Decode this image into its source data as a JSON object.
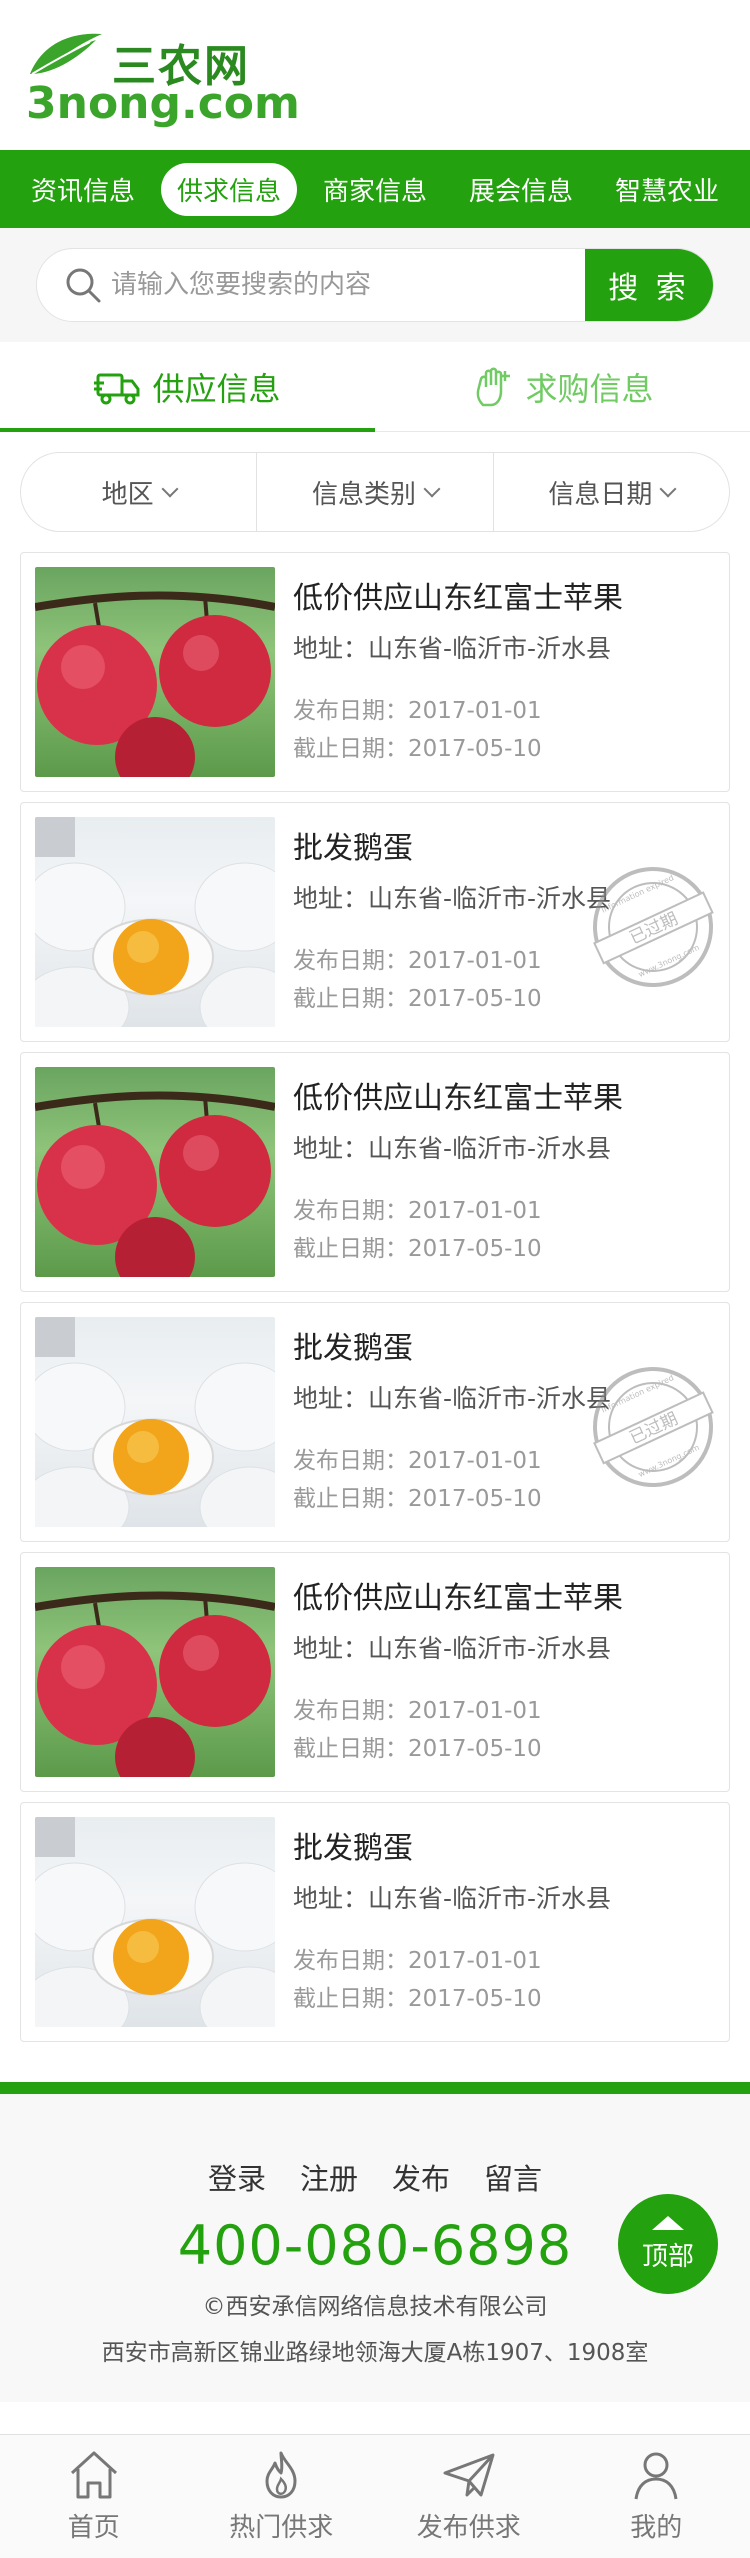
{
  "logo": {
    "cn": "三农网",
    "en": "3nong.com"
  },
  "nav": {
    "items": [
      {
        "label": "资讯信息",
        "active": false
      },
      {
        "label": "供求信息",
        "active": true
      },
      {
        "label": "商家信息",
        "active": false
      },
      {
        "label": "展会信息",
        "active": false
      },
      {
        "label": "智慧农业",
        "active": false
      }
    ]
  },
  "search": {
    "placeholder": "请输入您要搜索的内容",
    "button": "搜 索"
  },
  "tabs": [
    {
      "label": "供应信息",
      "icon": "truck-icon",
      "active": true
    },
    {
      "label": "求购信息",
      "icon": "hand-icon",
      "active": false
    }
  ],
  "filter": {
    "region": "地区",
    "category": "信息类别",
    "date": "信息日期"
  },
  "listings": [
    {
      "title": "低价供应山东红富士苹果",
      "address": "地址：山东省-临沂市-沂水县",
      "publish": "发布日期：2017-01-01",
      "deadline": "截止日期：2017-05-10",
      "image": "apple",
      "expired": false
    },
    {
      "title": "批发鹅蛋",
      "address": "地址：山东省-临沂市-沂水县",
      "publish": "发布日期：2017-01-01",
      "deadline": "截止日期：2017-05-10",
      "image": "egg",
      "expired": true
    },
    {
      "title": "低价供应山东红富士苹果",
      "address": "地址：山东省-临沂市-沂水县",
      "publish": "发布日期：2017-01-01",
      "deadline": "截止日期：2017-05-10",
      "image": "apple",
      "expired": false
    },
    {
      "title": "批发鹅蛋",
      "address": "地址：山东省-临沂市-沂水县",
      "publish": "发布日期：2017-01-01",
      "deadline": "截止日期：2017-05-10",
      "image": "egg",
      "expired": true
    },
    {
      "title": "低价供应山东红富士苹果",
      "address": "地址：山东省-临沂市-沂水县",
      "publish": "发布日期：2017-01-01",
      "deadline": "截止日期：2017-05-10",
      "image": "apple",
      "expired": false
    },
    {
      "title": "批发鹅蛋",
      "address": "地址：山东省-临沂市-沂水县",
      "publish": "发布日期：2017-01-01",
      "deadline": "截止日期：2017-05-10",
      "image": "egg",
      "expired": false
    }
  ],
  "stamp": {
    "text": "已过期",
    "ring_top": "Information expired",
    "ring_bottom": "www.3nong.com"
  },
  "footer": {
    "links": [
      "登录",
      "注册",
      "发布",
      "留言"
    ],
    "phone": "400-080-6898",
    "company": "©西安承信网络信息技术有限公司",
    "address": "西安市高新区锦业路绿地领海大厦A栋1907、1908室",
    "top_button": "顶部"
  },
  "bottombar": [
    {
      "label": "首页",
      "icon": "home-icon"
    },
    {
      "label": "热门供求",
      "icon": "flame-icon"
    },
    {
      "label": "发布供求",
      "icon": "send-icon"
    },
    {
      "label": "我的",
      "icon": "user-icon"
    }
  ],
  "colors": {
    "primary": "#24a10f",
    "light_green": "#6fcb62",
    "text": "#333333",
    "muted": "#999999"
  }
}
